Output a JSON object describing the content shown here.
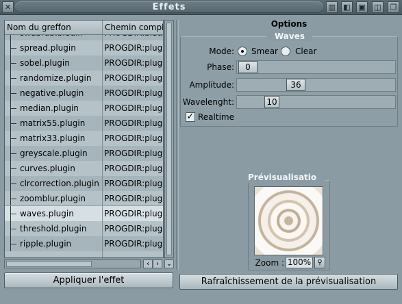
{
  "window": {
    "title": "Effets"
  },
  "list": {
    "columns": [
      "Nom du greffon",
      "Chemin comple"
    ],
    "rows": [
      {
        "name": "swaprgb.plugin",
        "path": "PROGDIR:plugi"
      },
      {
        "name": "spread.plugin",
        "path": "PROGDIR:plugi"
      },
      {
        "name": "sobel.plugin",
        "path": "PROGDIR:plugi"
      },
      {
        "name": "randomize.plugin",
        "path": "PROGDIR:plugi"
      },
      {
        "name": "negative.plugin",
        "path": "PROGDIR:plugi"
      },
      {
        "name": "median.plugin",
        "path": "PROGDIR:plugi"
      },
      {
        "name": "matrix55.plugin",
        "path": "PROGDIR:plugi"
      },
      {
        "name": "matrix33.plugin",
        "path": "PROGDIR:plugi"
      },
      {
        "name": "greyscale.plugin",
        "path": "PROGDIR:plugi"
      },
      {
        "name": "curves.plugin",
        "path": "PROGDIR:plugi"
      },
      {
        "name": "clrcorrection.plugin",
        "path": "PROGDIR:plugi"
      },
      {
        "name": "zoomblur.plugin",
        "path": "PROGDIR:plugi"
      },
      {
        "name": "waves.plugin",
        "path": "PROGDIR:plugi",
        "selected": true
      },
      {
        "name": "threshold.plugin",
        "path": "PROGDIR:plugi"
      },
      {
        "name": "ripple.plugin",
        "path": "PROGDIR:plugi"
      }
    ]
  },
  "buttons": {
    "apply": "Appliquer l'effet",
    "refresh": "Rafraîchissement de la prévisualisation"
  },
  "options": {
    "title": "Options",
    "group_title": "Waves",
    "mode_label": "Mode:",
    "mode_options": [
      "Smear",
      "Clear"
    ],
    "mode_selected": "Smear",
    "phase_label": "Phase:",
    "phase_value": "0",
    "amplitude_label": "Amplitude:",
    "amplitude_value": "36",
    "wavelength_label": "Wavelenght:",
    "wavelength_value": "10",
    "realtime_label": "Realtime",
    "realtime_checked": true
  },
  "preview": {
    "title": "Prévisualisatio",
    "zoom_label": "Zoom :",
    "zoom_value": "100%"
  }
}
